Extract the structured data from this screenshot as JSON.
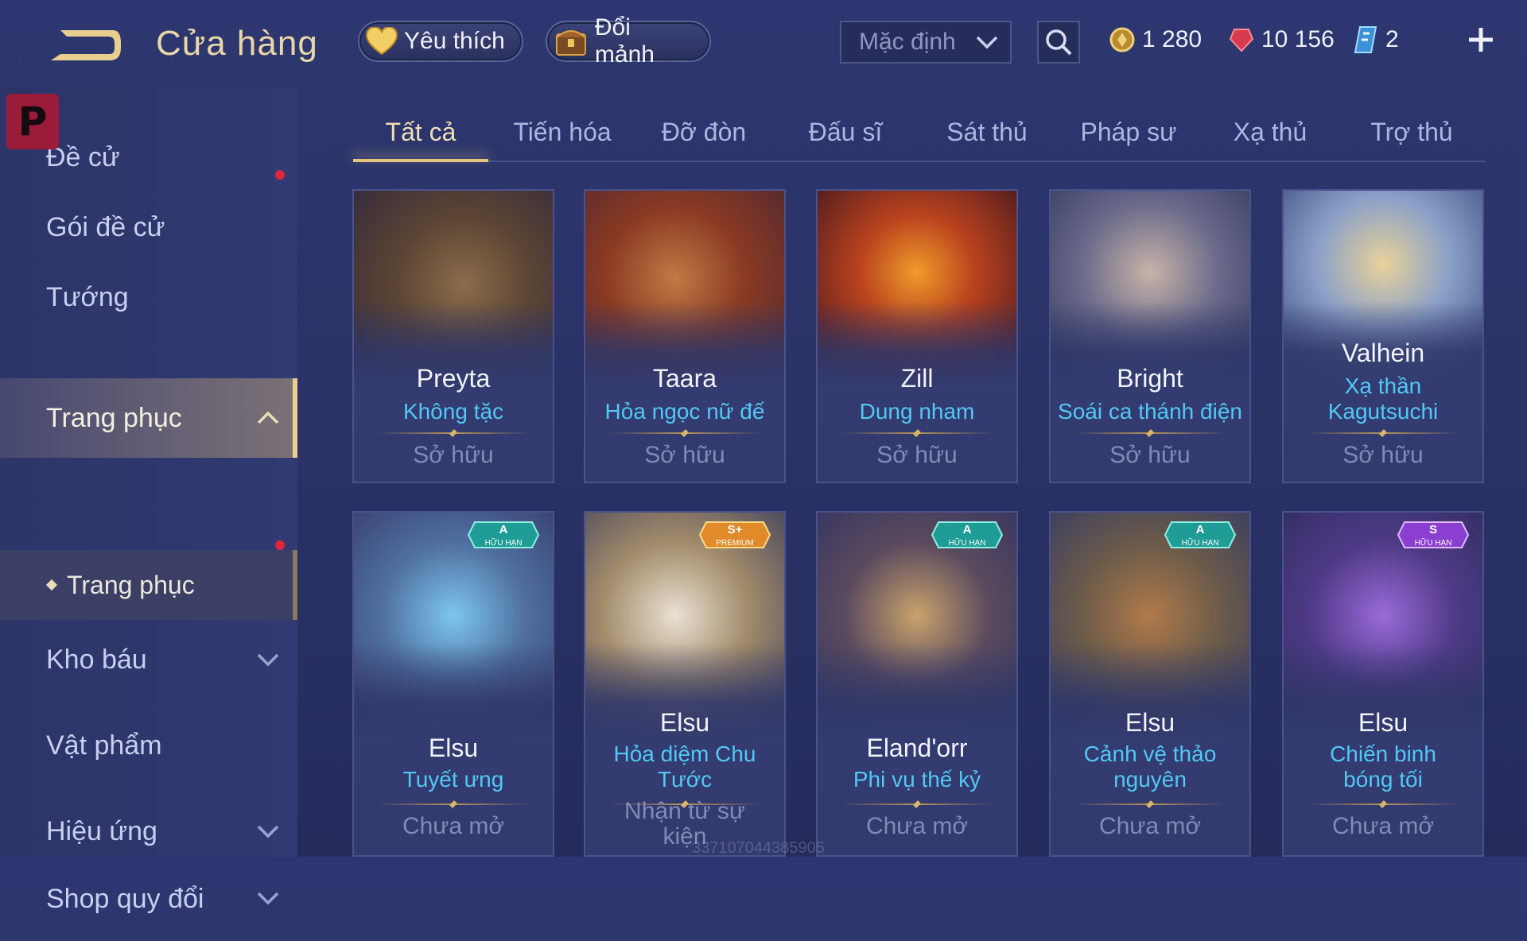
{
  "header": {
    "title": "Cửa hàng",
    "favorites_label": "Yêu thích",
    "fragments_label": "Đổi mảnh",
    "sort_value": "Mặc định",
    "currencies": {
      "gold": "1 280",
      "ruby": "10 156",
      "token": "2"
    }
  },
  "sidebar": {
    "badge": "P",
    "items": [
      {
        "label": "Đề cử"
      },
      {
        "label": "Gói đề cử"
      },
      {
        "label": "Tướng"
      },
      {
        "label": "Trang phục"
      },
      {
        "label": "Kho báu"
      },
      {
        "label": "Vật phẩm"
      },
      {
        "label": "Hiệu ứng"
      },
      {
        "label": "Shop quy đổi"
      }
    ],
    "sub_item": "Trang phục"
  },
  "tabs": [
    "Tất cả",
    "Tiến hóa",
    "Đỡ đòn",
    "Đấu sĩ",
    "Sát thủ",
    "Pháp sư",
    "Xạ thủ",
    "Trợ thủ"
  ],
  "cards": [
    {
      "hero": "Preyta",
      "skin": "Không tặc",
      "status": "Sở hữu"
    },
    {
      "hero": "Taara",
      "skin": "Hỏa ngọc nữ đế",
      "status": "Sở hữu"
    },
    {
      "hero": "Zill",
      "skin": "Dung nham",
      "status": "Sở hữu"
    },
    {
      "hero": "Bright",
      "skin": "Soái ca thánh điện",
      "status": "Sở hữu"
    },
    {
      "hero": "Valhein",
      "skin": "Xạ thần Kagutsuchi",
      "status": "Sở hữu"
    },
    {
      "hero": "Elsu",
      "skin": "Tuyết ưng",
      "status": "Chưa mở",
      "tier": "A",
      "tier_sub": "HỮU HẠN"
    },
    {
      "hero": "Elsu",
      "skin": "Hỏa diệm Chu Tước",
      "status": "Nhận từ sự kiện",
      "tier": "S+",
      "tier_sub": "PREMIUM"
    },
    {
      "hero": "Eland'orr",
      "skin": "Phi vụ thế kỷ",
      "status": "Chưa mở",
      "tier": "A",
      "tier_sub": "HỮU HẠN"
    },
    {
      "hero": "Elsu",
      "skin": "Cảnh vệ thảo nguyên",
      "status": "Chưa mở",
      "tier": "A",
      "tier_sub": "HỮU HẠN"
    },
    {
      "hero": "Elsu",
      "skin": "Chiến binh bóng tối",
      "status": "Chưa mở",
      "tier": "S",
      "tier_sub": "HỮU HẠN"
    }
  ],
  "watermark": "337107044385905",
  "colors": {
    "accent_gold": "#e3c57d",
    "skin_name": "#52c8f5",
    "notification": "#e0263a",
    "tier_a": "#1f9c95",
    "tier_s_plus": "#e08a2a",
    "tier_s": "#8a3fd1"
  }
}
